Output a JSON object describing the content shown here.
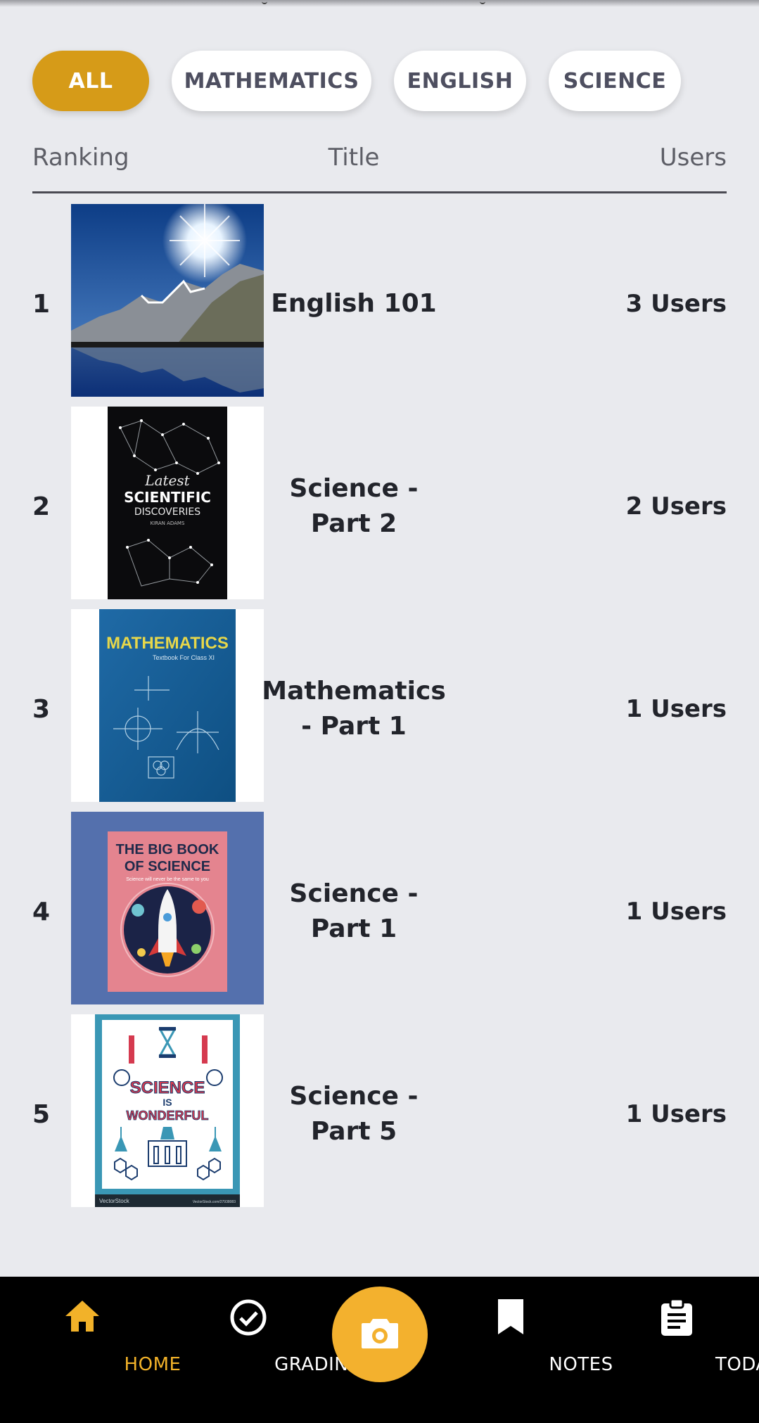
{
  "filters": [
    {
      "label": "ALL",
      "active": true
    },
    {
      "label": "MATHEMATICS",
      "active": false
    },
    {
      "label": "ENGLISH",
      "active": false
    },
    {
      "label": "SCIENCE",
      "active": false
    }
  ],
  "table": {
    "headers": {
      "ranking": "Ranking",
      "title": "Title",
      "users": "Users"
    },
    "rows": [
      {
        "rank": "1",
        "title": "English 101",
        "users": "3 Users",
        "cover": {
          "type": "landscape"
        }
      },
      {
        "rank": "2",
        "title": "Science - Part 2",
        "users": "2 Users",
        "cover": {
          "type": "scientific",
          "line1": "Latest",
          "line2": "SCIENTIFIC",
          "line3": "DISCOVERIES",
          "author": "KIRAN ADAMS"
        }
      },
      {
        "rank": "3",
        "title": "Mathematics - Part 1",
        "users": "1 Users",
        "cover": {
          "type": "math",
          "line1": "MATHEMATICS",
          "line2": "Textbook For Class XI"
        }
      },
      {
        "rank": "4",
        "title": "Science - Part 1",
        "users": "1 Users",
        "cover": {
          "type": "bigbook",
          "line1": "THE BIG BOOK",
          "line2": "OF SCIENCE",
          "line3": "Science will never be the same to you"
        }
      },
      {
        "rank": "5",
        "title": "Science - Part 5",
        "users": "1 Users",
        "cover": {
          "type": "wonderful",
          "line1": "SCIENCE",
          "line2": "IS",
          "line3": "WONDERFUL",
          "footer_left": "VectorStock",
          "footer_right": "VectorStock.com/27938083"
        }
      }
    ]
  },
  "nav": {
    "home": "HOME",
    "grading": "GRADING",
    "notes": "NOTES",
    "today": "TODAY"
  },
  "colors": {
    "accent": "#d69b18",
    "nav_active": "#f2b229",
    "camera": "#f3b12e"
  }
}
